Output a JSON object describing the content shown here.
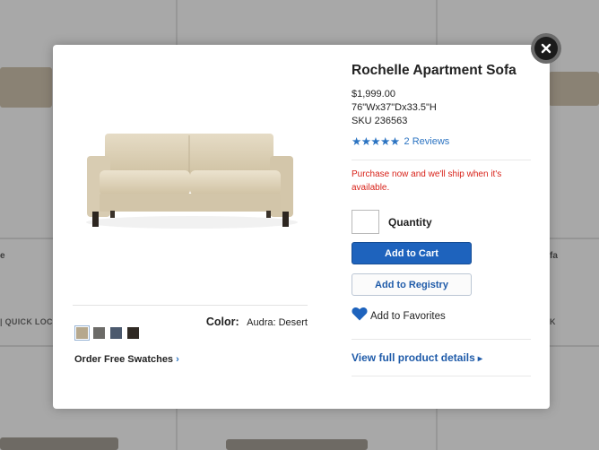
{
  "background": {
    "left_partial_title": "e",
    "right_partial_title": "fa",
    "left_quick_look": "QUICK LOC",
    "right_quick_look": "K"
  },
  "modal": {
    "close_icon": "close-x-icon",
    "product": {
      "title": "Rochelle Apartment Sofa",
      "price": "$1,999.00",
      "dimensions": "76\"Wx37\"Dx33.5\"H",
      "sku": "SKU 236563",
      "rating_stars": "★★★★★",
      "rating_value": 5,
      "reviews_link": "2 Reviews",
      "notice": "Purchase now and we'll ship when it's available."
    },
    "color": {
      "label": "Color:",
      "value": "Audra: Desert",
      "swatches": [
        {
          "name": "Desert",
          "color": "#b6a88d",
          "selected": true
        },
        {
          "name": "Grey",
          "color": "#6c6b68",
          "selected": false
        },
        {
          "name": "Slate Blue",
          "color": "#4c5a6e",
          "selected": false
        },
        {
          "name": "Charcoal",
          "color": "#302a24",
          "selected": false
        }
      ],
      "order_swatches": "Order Free Swatches"
    },
    "quantity": {
      "label": "Quantity",
      "value": ""
    },
    "buttons": {
      "add_to_cart": "Add to Cart",
      "add_to_registry": "Add to Registry"
    },
    "favorites": {
      "label": "Add to Favorites",
      "icon": "heart-icon"
    },
    "view_details": "View full product details",
    "colors": {
      "accent_blue": "#1e63bd",
      "link_blue": "#2c74c2",
      "notice_red": "#d8231a"
    }
  }
}
